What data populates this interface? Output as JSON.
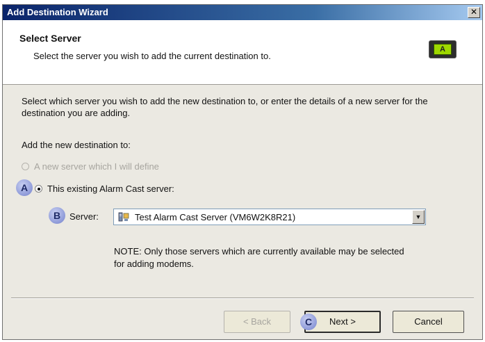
{
  "window": {
    "title": "Add Destination Wizard",
    "close_glyph": "✕"
  },
  "header": {
    "title": "Select Server",
    "subtitle": "Select the server you wish to add the current destination to.",
    "logo_letter": "A"
  },
  "content": {
    "intro": "Select which server you wish to add the new destination to, or enter the details of a new server for the destination you are adding.",
    "add_to_label": "Add the new destination to:",
    "options": [
      {
        "label": "A new server which I will define",
        "checked": false,
        "enabled": false
      },
      {
        "label": "This existing Alarm Cast server:",
        "checked": true,
        "enabled": true
      }
    ],
    "server_label": "Server:",
    "server_value": "Test Alarm Cast Server (VM6W2K8R21)",
    "note": "NOTE: Only those servers which are currently available may be selected for adding modems."
  },
  "annotations": {
    "a": "A",
    "b": "B",
    "c": "C"
  },
  "buttons": {
    "back": "< Back",
    "next": "Next >",
    "cancel": "Cancel"
  },
  "icons": {
    "server": "server-icon",
    "dropdown": "chevron-down-icon",
    "logo": "alarm-cast-logo-icon"
  },
  "colors": {
    "titlebar_start": "#0a246a",
    "titlebar_end": "#a6caf0",
    "dialog_bg": "#ebe9e2",
    "badge": "#8d99d8"
  }
}
